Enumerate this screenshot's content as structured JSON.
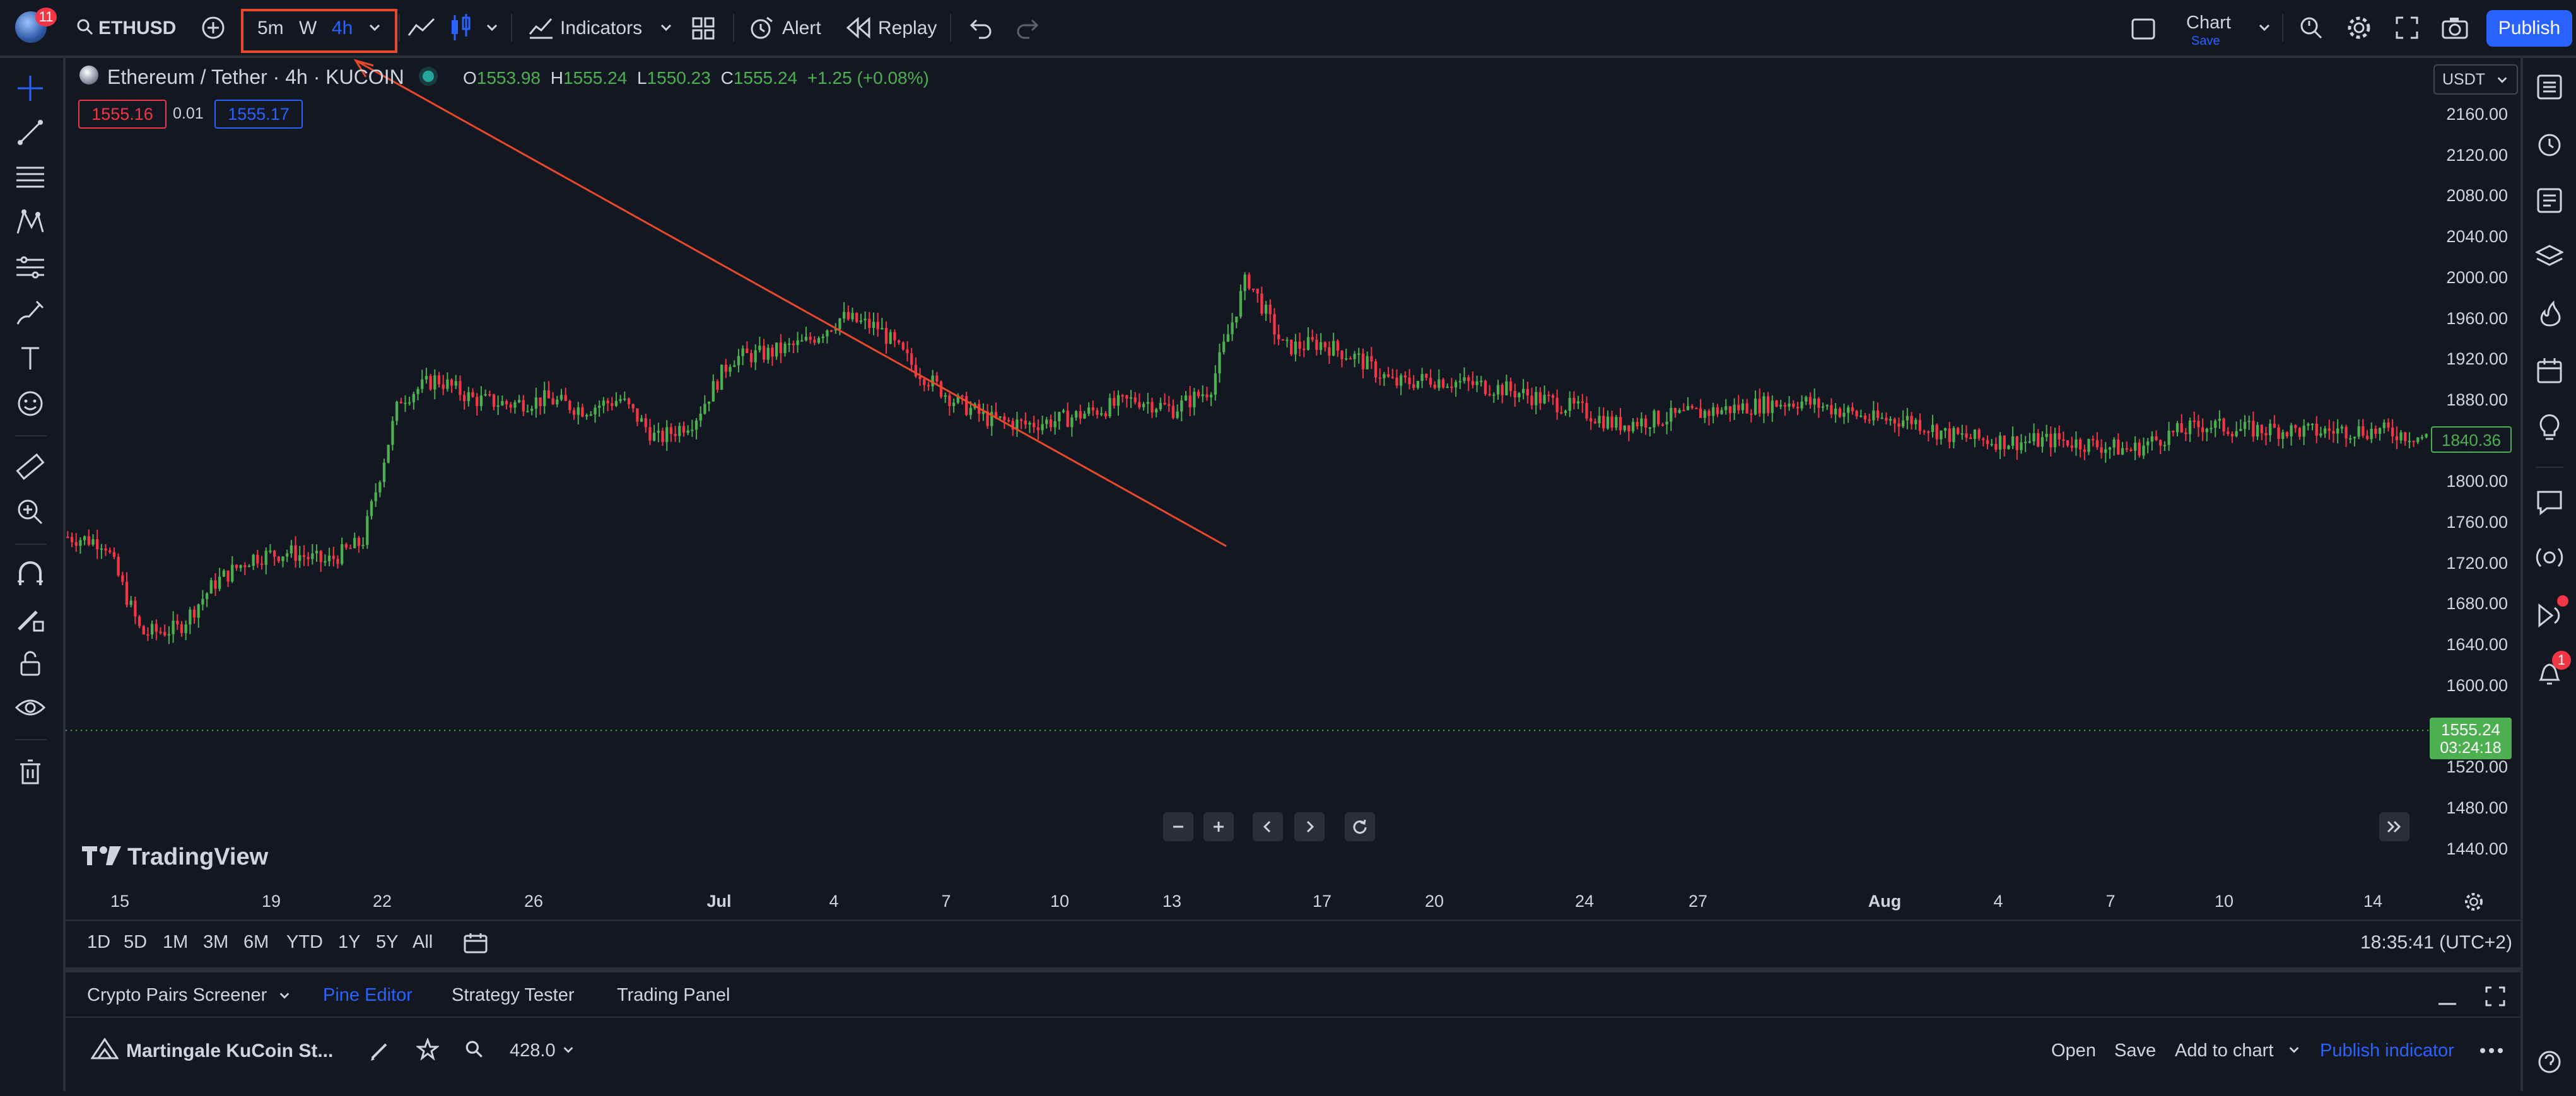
{
  "topbar": {
    "symbol": "ETHUSD",
    "notif_count": "11",
    "intervals": [
      "5m",
      "W",
      "4h"
    ],
    "indicators_label": "Indicators",
    "alert_label": "Alert",
    "replay_label": "Replay",
    "layout_name": "Chart",
    "layout_save": "Save",
    "publish_label": "Publish"
  },
  "legend": {
    "title": "Ethereum / Tether · 4h · KUCOIN",
    "o_label": "O",
    "o_value": "1553.98",
    "h_label": "H",
    "h_value": "1555.24",
    "l_label": "L",
    "l_value": "1550.23",
    "c_label": "C",
    "c_value": "1555.24",
    "change": "+1.25 (+0.08%)",
    "sell_price": "1555.16",
    "spread": "0.01",
    "buy_price": "1555.17"
  },
  "price_axis": {
    "currency": "USDT",
    "ticks": [
      "2160.00",
      "2120.00",
      "2080.00",
      "2040.00",
      "2000.00",
      "1960.00",
      "1920.00",
      "1880.00",
      "1840.00",
      "1800.00",
      "1760.00",
      "1720.00",
      "1680.00",
      "1640.00",
      "1600.00",
      "1560.00",
      "1520.00",
      "1480.00",
      "1440.00"
    ],
    "marker_price": "1840.36",
    "last_price": "1555.24",
    "countdown": "03:24:18"
  },
  "time_axis": {
    "ticks": [
      "15",
      "19",
      "22",
      "26",
      "Jul",
      "4",
      "7",
      "10",
      "13",
      "17",
      "20",
      "24",
      "27",
      "Aug",
      "4",
      "7",
      "10",
      "14"
    ]
  },
  "ranges": [
    "1D",
    "5D",
    "1M",
    "3M",
    "6M",
    "YTD",
    "1Y",
    "5Y",
    "All"
  ],
  "clock": "18:35:41 (UTC+2)",
  "watermark": "TradingView",
  "panel": {
    "tabs": [
      "Crypto Pairs Screener",
      "Pine Editor",
      "Strategy Tester",
      "Trading Panel"
    ],
    "script_name": "Martingale KuCoin St...",
    "version": "428.0",
    "open_label": "Open",
    "save_label": "Save",
    "add_to_chart_label": "Add to chart",
    "publish_indicator_label": "Publish indicator"
  },
  "alerts_badge": "1",
  "colors": {
    "up": "#22ab94",
    "up_bright": "#4caf50",
    "down": "#f23645",
    "accent": "#2962ff",
    "trendline": "#e8492b",
    "background": "#131722"
  },
  "chart_data": {
    "type": "candlestick",
    "symbol": "Ethereum / Tether",
    "interval": "4h",
    "exchange": "KUCOIN",
    "ylim": [
      1420,
      2180
    ],
    "path_points": [
      {
        "t": "Jun 12",
        "price": 1745
      },
      {
        "t": "Jun 13",
        "price": 1740
      },
      {
        "t": "Jun 14",
        "price": 1650
      },
      {
        "t": "Jun 15",
        "price": 1655
      },
      {
        "t": "Jun 16",
        "price": 1700
      },
      {
        "t": "Jun 17",
        "price": 1725
      },
      {
        "t": "Jun 18",
        "price": 1730
      },
      {
        "t": "Jun 19",
        "price": 1720
      },
      {
        "t": "Jun 20",
        "price": 1740
      },
      {
        "t": "Jun 21",
        "price": 1880
      },
      {
        "t": "Jun 22",
        "price": 1900
      },
      {
        "t": "Jun 23",
        "price": 1880
      },
      {
        "t": "Jun 24",
        "price": 1875
      },
      {
        "t": "Jun 25",
        "price": 1880
      },
      {
        "t": "Jun 26",
        "price": 1870
      },
      {
        "t": "Jun 27",
        "price": 1880
      },
      {
        "t": "Jun 28",
        "price": 1840
      },
      {
        "t": "Jun 29",
        "price": 1860
      },
      {
        "t": "Jun 30",
        "price": 1920
      },
      {
        "t": "Jul 1",
        "price": 1925
      },
      {
        "t": "Jul 2",
        "price": 1935
      },
      {
        "t": "Jul 3",
        "price": 1960
      },
      {
        "t": "Jul 4",
        "price": 1950
      },
      {
        "t": "Jul 5",
        "price": 1910
      },
      {
        "t": "Jul 6",
        "price": 1880
      },
      {
        "t": "Jul 7",
        "price": 1860
      },
      {
        "t": "Jul 8",
        "price": 1855
      },
      {
        "t": "Jul 9",
        "price": 1860
      },
      {
        "t": "Jul 10",
        "price": 1870
      },
      {
        "t": "Jul 11",
        "price": 1880
      },
      {
        "t": "Jul 12",
        "price": 1870
      },
      {
        "t": "Jul 13",
        "price": 1890
      },
      {
        "t": "Jul 14",
        "price": 2000
      },
      {
        "t": "Jul 15",
        "price": 1930
      },
      {
        "t": "Jul 16",
        "price": 1935
      },
      {
        "t": "Jul 17",
        "price": 1920
      },
      {
        "t": "Jul 18",
        "price": 1895
      },
      {
        "t": "Jul 19",
        "price": 1900
      },
      {
        "t": "Jul 20",
        "price": 1895
      },
      {
        "t": "Jul 21",
        "price": 1890
      },
      {
        "t": "Jul 22",
        "price": 1880
      },
      {
        "t": "Jul 23",
        "price": 1870
      },
      {
        "t": "Jul 24",
        "price": 1855
      },
      {
        "t": "Jul 25",
        "price": 1860
      },
      {
        "t": "Jul 26",
        "price": 1865
      },
      {
        "t": "Jul 27",
        "price": 1870
      },
      {
        "t": "Jul 28",
        "price": 1875
      },
      {
        "t": "Jul 29",
        "price": 1878
      },
      {
        "t": "Jul 30",
        "price": 1870
      },
      {
        "t": "Jul 31",
        "price": 1860
      },
      {
        "t": "Aug 1",
        "price": 1860
      },
      {
        "t": "Aug 2",
        "price": 1845
      },
      {
        "t": "Aug 3",
        "price": 1840
      },
      {
        "t": "Aug 4",
        "price": 1838
      },
      {
        "t": "Aug 5",
        "price": 1840
      },
      {
        "t": "Aug 6",
        "price": 1835
      },
      {
        "t": "Aug 7",
        "price": 1830
      },
      {
        "t": "Aug 8",
        "price": 1845
      },
      {
        "t": "Aug 9",
        "price": 1855
      },
      {
        "t": "Aug 10",
        "price": 1850
      },
      {
        "t": "Aug 11",
        "price": 1850
      },
      {
        "t": "Aug 12",
        "price": 1848
      },
      {
        "t": "Aug 13",
        "price": 1850
      },
      {
        "t": "Aug 14",
        "price": 1848
      },
      {
        "t": "Aug 15",
        "price": 1842
      }
    ],
    "trendline": [
      {
        "t": "Jun 21",
        "price": 2220
      },
      {
        "t": "Jul 13",
        "price": 1750
      }
    ],
    "last_price": 1555.24
  }
}
